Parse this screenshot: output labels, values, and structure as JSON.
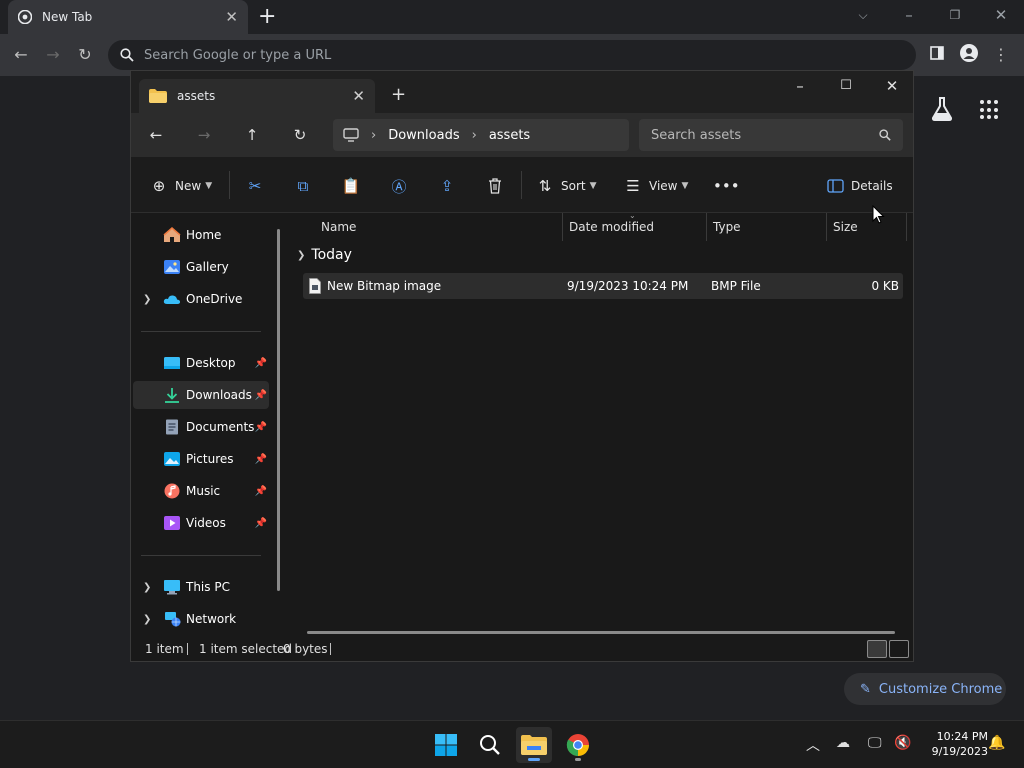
{
  "chrome": {
    "tab_title": "New Tab",
    "omnibox_placeholder": "Search Google or type a URL",
    "customize_label": "Customize Chrome"
  },
  "explorer": {
    "tab_title": "assets",
    "breadcrumb": [
      "Downloads",
      "assets"
    ],
    "search_placeholder": "Search assets",
    "commands": {
      "new": "New",
      "sort": "Sort",
      "view": "View",
      "details": "Details"
    },
    "sidebar": {
      "items": [
        {
          "label": "Home",
          "icon": "home-icon"
        },
        {
          "label": "Gallery",
          "icon": "gallery-icon"
        },
        {
          "label": "OneDrive",
          "icon": "onedrive-icon"
        },
        {
          "label": "Desktop",
          "icon": "desktop-icon"
        },
        {
          "label": "Downloads",
          "icon": "downloads-icon"
        },
        {
          "label": "Documents",
          "icon": "documents-icon"
        },
        {
          "label": "Pictures",
          "icon": "pictures-icon"
        },
        {
          "label": "Music",
          "icon": "music-icon"
        },
        {
          "label": "Videos",
          "icon": "videos-icon"
        },
        {
          "label": "This PC",
          "icon": "this-pc-icon"
        },
        {
          "label": "Network",
          "icon": "network-icon"
        }
      ]
    },
    "columns": [
      "Name",
      "Date modified",
      "Type",
      "Size"
    ],
    "group": "Today",
    "files": [
      {
        "name": "New Bitmap image",
        "date": "9/19/2023 10:24 PM",
        "type": "BMP File",
        "size": "0 KB"
      }
    ],
    "status": {
      "count": "1 item",
      "selected": "1 item selected",
      "bytes": "0 bytes"
    }
  },
  "taskbar": {
    "time": "10:24 PM",
    "date": "9/19/2023"
  },
  "colors": {
    "accent": "#60a5fa",
    "chrome_link": "#8ab4f8"
  }
}
